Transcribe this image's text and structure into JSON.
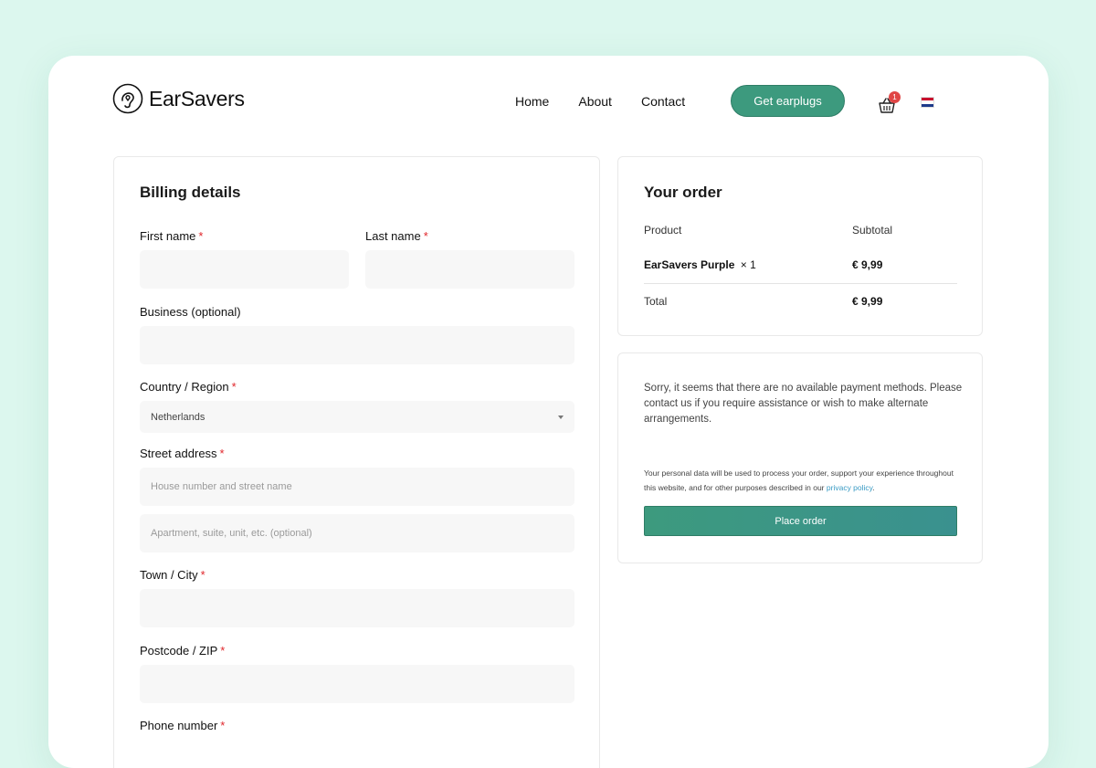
{
  "brand": {
    "name": "EarSavers"
  },
  "nav": {
    "home": "Home",
    "about": "About",
    "contact": "Contact"
  },
  "header": {
    "cta_label": "Get earplugs",
    "cart_count": "1",
    "language_flag": "nl-flag-icon"
  },
  "billing": {
    "title": "Billing details",
    "required_mark": "*",
    "first_name_label": "First name",
    "last_name_label": "Last name",
    "business_label": "Business (optional)",
    "country_label": "Country / Region",
    "country_value": "Netherlands",
    "street_label": "Street address",
    "street_placeholder": "House number and street name",
    "apartment_placeholder": "Apartment, suite, unit, etc. (optional)",
    "town_label": "Town / City",
    "postcode_label": "Postcode / ZIP",
    "phone_label": "Phone number"
  },
  "order": {
    "title": "Your order",
    "col_product": "Product",
    "col_subtotal": "Subtotal",
    "item_name": "EarSavers Purple",
    "item_qty": "× 1",
    "item_subtotal": "€ 9,99",
    "total_label": "Total",
    "total_value": "€ 9,99"
  },
  "payment": {
    "message": "Sorry, it seems that there are no available payment methods. Please contact us if you require assistance or wish to make alternate arrangements.",
    "privacy_text": "Your personal data will be used to process your order, support your experience throughout this website, and for other purposes described in our",
    "privacy_link": "privacy policy",
    "privacy_end": ".",
    "place_order_label": "Place order"
  },
  "colors": {
    "accent": "#3d9a7e",
    "background": "#dcf7ee",
    "required": "#e0262b",
    "link": "#3a9bc4"
  }
}
